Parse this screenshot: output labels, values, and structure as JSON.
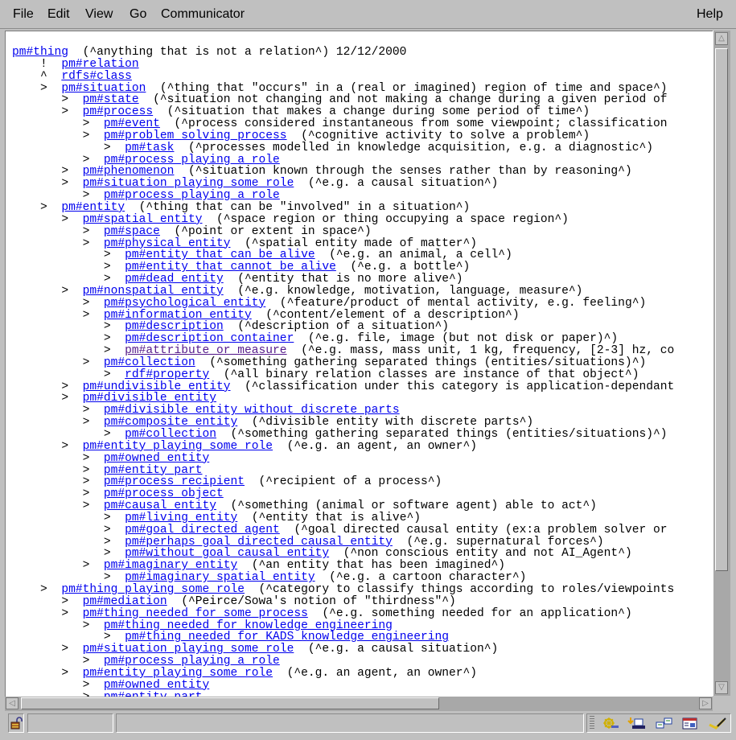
{
  "menubar": {
    "items": [
      "File",
      "Edit",
      "View",
      "Go",
      "Communicator"
    ],
    "help": "Help"
  },
  "header": {
    "root_link": "pm#thing",
    "root_comment": "(^anything that is not a relation^) 12/12/2000"
  },
  "tree": [
    {
      "indent": 0,
      "marker": "",
      "link": "pm#thing",
      "comment": "(^anything that is not a relation^) 12/12/2000"
    },
    {
      "indent": 1,
      "marker": "!",
      "link": "pm#relation",
      "comment": ""
    },
    {
      "indent": 1,
      "marker": "^",
      "link": "rdfs#class",
      "comment": ""
    },
    {
      "indent": 1,
      "marker": ">",
      "link": "pm#situation",
      "comment": "(^thing that \"occurs\" in a (real or imagined) region of time and space^)"
    },
    {
      "indent": 2,
      "marker": ">",
      "link": "pm#state",
      "comment": "(^situation not changing and not making a change during a given period of"
    },
    {
      "indent": 2,
      "marker": ">",
      "link": "pm#process",
      "comment": "(^situation that makes a change during some period of time^)"
    },
    {
      "indent": 3,
      "marker": ">",
      "link": "pm#event",
      "comment": "(^process considered instantaneous from some viewpoint; classification"
    },
    {
      "indent": 3,
      "marker": ">",
      "link": "pm#problem_solving_process",
      "comment": "(^cognitive activity to solve a problem^)"
    },
    {
      "indent": 4,
      "marker": ">",
      "link": "pm#task",
      "comment": "(^processes modelled in knowledge acquisition, e.g. a diagnostic^)"
    },
    {
      "indent": 3,
      "marker": ">",
      "link": "pm#process_playing_a_role",
      "comment": ""
    },
    {
      "indent": 2,
      "marker": ">",
      "link": "pm#phenomenon",
      "comment": "(^situation known through the senses rather than by reasoning^)"
    },
    {
      "indent": 2,
      "marker": ">",
      "link": "pm#situation_playing_some_role",
      "comment": "(^e.g. a causal situation^)"
    },
    {
      "indent": 3,
      "marker": ">",
      "link": "pm#process_playing_a_role",
      "comment": ""
    },
    {
      "indent": 1,
      "marker": ">",
      "link": "pm#entity",
      "comment": "(^thing that can be \"involved\" in a situation^)"
    },
    {
      "indent": 2,
      "marker": ">",
      "link": "pm#spatial_entity",
      "comment": "(^space region or thing occupying a space region^)"
    },
    {
      "indent": 3,
      "marker": ">",
      "link": "pm#space",
      "comment": "(^point or extent in space^)"
    },
    {
      "indent": 3,
      "marker": ">",
      "link": "pm#physical_entity",
      "comment": "(^spatial entity made of matter^)"
    },
    {
      "indent": 4,
      "marker": ">",
      "link": "pm#entity_that_can_be_alive",
      "comment": "(^e.g. an animal, a cell^)"
    },
    {
      "indent": 4,
      "marker": ">",
      "link": "pm#entity_that_cannot_be_alive",
      "comment": "(^e.g. a bottle^)"
    },
    {
      "indent": 4,
      "marker": ">",
      "link": "pm#dead_entity",
      "comment": "(^entity that is no more alive^)"
    },
    {
      "indent": 2,
      "marker": ">",
      "link": "pm#nonspatial_entity",
      "comment": "(^e.g. knowledge, motivation, language, measure^)"
    },
    {
      "indent": 3,
      "marker": ">",
      "link": "pm#psychological_entity",
      "comment": "(^feature/product of mental activity, e.g. feeling^)"
    },
    {
      "indent": 3,
      "marker": ">",
      "link": "pm#information_entity",
      "comment": "(^content/element of a description^)"
    },
    {
      "indent": 4,
      "marker": ">",
      "link": "pm#description",
      "comment": "(^description of a situation^)"
    },
    {
      "indent": 4,
      "marker": ">",
      "link": "pm#description_container",
      "comment": "(^e.g. file, image (but not disk or paper)^)"
    },
    {
      "indent": 4,
      "marker": ">",
      "link": "pm#attribute_or_measure",
      "comment": "(^e.g. mass, mass unit, 1 kg, frequency, [2-3] hz, co",
      "visited": true
    },
    {
      "indent": 3,
      "marker": ">",
      "link": "pm#collection",
      "comment": "(^something gathering separated things (entities/situations)^)"
    },
    {
      "indent": 4,
      "marker": ">",
      "link": "rdf#property",
      "comment": "(^all binary relation classes are instance of that object^)"
    },
    {
      "indent": 2,
      "marker": ">",
      "link": "pm#undivisible_entity",
      "comment": "(^classification under this category is application-dependant"
    },
    {
      "indent": 2,
      "marker": ">",
      "link": "pm#divisible_entity",
      "comment": ""
    },
    {
      "indent": 3,
      "marker": ">",
      "link": "pm#divisible_entity_without_discrete_parts",
      "comment": ""
    },
    {
      "indent": 3,
      "marker": ">",
      "link": "pm#composite_entity",
      "comment": "(^divisible entity with discrete parts^)"
    },
    {
      "indent": 4,
      "marker": ">",
      "link": "pm#collection",
      "comment": "(^something gathering separated things (entities/situations)^)"
    },
    {
      "indent": 2,
      "marker": ">",
      "link": "pm#entity_playing_some_role",
      "comment": "(^e.g. an agent, an owner^)"
    },
    {
      "indent": 3,
      "marker": ">",
      "link": "pm#owned_entity",
      "comment": ""
    },
    {
      "indent": 3,
      "marker": ">",
      "link": "pm#entity_part",
      "comment": ""
    },
    {
      "indent": 3,
      "marker": ">",
      "link": "pm#process_recipient",
      "comment": "(^recipient of a process^)"
    },
    {
      "indent": 3,
      "marker": ">",
      "link": "pm#process_object",
      "comment": ""
    },
    {
      "indent": 3,
      "marker": ">",
      "link": "pm#causal_entity",
      "comment": "(^something (animal or software agent) able to act^)"
    },
    {
      "indent": 4,
      "marker": ">",
      "link": "pm#living_entity",
      "comment": "(^entity that is alive^)"
    },
    {
      "indent": 4,
      "marker": ">",
      "link": "pm#goal_directed_agent",
      "comment": "(^goal directed causal entity (ex:a problem solver or"
    },
    {
      "indent": 4,
      "marker": ">",
      "link": "pm#perhaps_goal_directed_causal_entity",
      "comment": "(^e.g. supernatural forces^)"
    },
    {
      "indent": 4,
      "marker": ">",
      "link": "pm#without_goal_causal_entity",
      "comment": "(^non conscious entity and not AI_Agent^)"
    },
    {
      "indent": 3,
      "marker": ">",
      "link": "pm#imaginary_entity",
      "comment": "(^an entity that has been imagined^)"
    },
    {
      "indent": 4,
      "marker": ">",
      "link": "pm#imaginary_spatial_entity",
      "comment": "(^e.g. a cartoon character^)"
    },
    {
      "indent": 1,
      "marker": ">",
      "link": "pm#thing_playing_some_role",
      "comment": "(^category to classify things according to roles/viewpoints"
    },
    {
      "indent": 2,
      "marker": ">",
      "link": "pm#mediation",
      "comment": "(^Peirce/Sowa's notion of \"thirdness\"^)"
    },
    {
      "indent": 2,
      "marker": ">",
      "link": "pm#thing_needed_for_some_process",
      "comment": "(^e.g. something needed for an application^)"
    },
    {
      "indent": 3,
      "marker": ">",
      "link": "pm#thing_needed_for_knowledge_engineering",
      "comment": ""
    },
    {
      "indent": 4,
      "marker": ">",
      "link": "pm#thing_needed_for_KADS_knowledge_engineering",
      "comment": ""
    },
    {
      "indent": 2,
      "marker": ">",
      "link": "pm#situation_playing_some_role",
      "comment": "(^e.g. a causal situation^)"
    },
    {
      "indent": 3,
      "marker": ">",
      "link": "pm#process_playing_a_role",
      "comment": ""
    },
    {
      "indent": 2,
      "marker": ">",
      "link": "pm#entity_playing_some_role",
      "comment": "(^e.g. an agent, an owner^)"
    },
    {
      "indent": 3,
      "marker": ">",
      "link": "pm#owned_entity",
      "comment": ""
    },
    {
      "indent": 3,
      "marker": ">",
      "link": "pm#entity_part",
      "comment": ""
    }
  ],
  "colors": {
    "link": "#0000ee",
    "visited_link": "#551a8b",
    "chrome": "#c0c0c0"
  },
  "statusbar": {
    "security_icon": "unlocked-padlock-icon",
    "status_text": "",
    "component_icons": [
      "navigator-icon",
      "mailbox-icon",
      "discussion-groups-icon",
      "address-book-icon",
      "composer-icon"
    ]
  },
  "scroll": {
    "vertical_position": 0,
    "horizontal_position": 0
  }
}
